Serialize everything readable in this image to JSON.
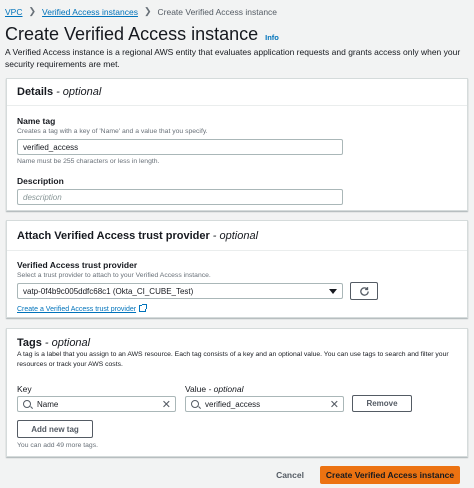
{
  "breadcrumb": {
    "items": [
      {
        "label": "VPC"
      },
      {
        "label": "Verified Access instances"
      },
      {
        "label": "Create Verified Access instance"
      }
    ],
    "separator": "❯"
  },
  "page": {
    "title": "Create Verified Access instance",
    "info_link": "Info",
    "description": "A Verified Access instance is a regional AWS entity that evaluates application requests and grants access only when your security requirements are met."
  },
  "details": {
    "heading": "Details",
    "optional": "- optional",
    "name_tag": {
      "label": "Name tag",
      "description": "Creates a tag with a key of 'Name' and a value that you specify.",
      "value": "verified_access",
      "constraint": "Name must be 255 characters or less in length."
    },
    "description_field": {
      "label": "Description",
      "placeholder": "description"
    }
  },
  "trust_provider": {
    "heading": "Attach Verified Access trust provider",
    "optional": "- optional",
    "label": "Verified Access trust provider",
    "description": "Select a trust provider to attach to your Verified Access instance.",
    "selected": "vatp-0f4b9c005ddfc68c1 (Okta_CI_CUBE_Test)",
    "create_link": "Create a Verified Access trust provider"
  },
  "tags": {
    "heading": "Tags",
    "optional": "- optional",
    "description": "A tag is a label that you assign to an AWS resource. Each tag consists of a key and an optional value. You can use tags to search and filter your resources or track your AWS costs.",
    "key_label": "Key",
    "value_label": "Value",
    "value_optional": "- optional",
    "rows": [
      {
        "key": "Name",
        "value": "verified_access"
      }
    ],
    "remove_label": "Remove",
    "add_label": "Add new tag",
    "remaining": "You can add 49 more tags."
  },
  "footer": {
    "cancel_label": "Cancel",
    "submit_label": "Create Verified Access instance"
  },
  "colors": {
    "link": "#0073bb",
    "primary": "#ec7211",
    "background": "#f2f3f3"
  }
}
